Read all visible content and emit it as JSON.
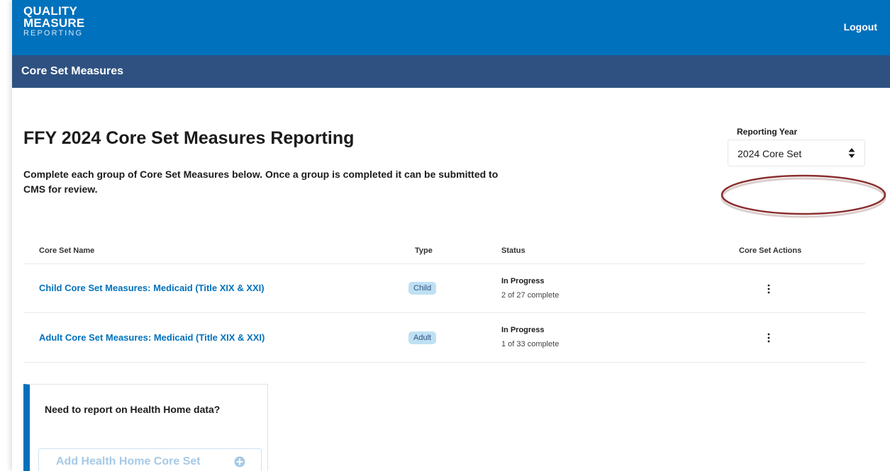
{
  "header": {
    "logo_line1": "QUALITY",
    "logo_line2": "MEASURE",
    "logo_line3": "REPORTING",
    "logout_label": "Logout",
    "primary_color": "#0071bc"
  },
  "subheader": {
    "title": "Core Set Measures",
    "color": "#2e5181"
  },
  "page": {
    "title": "FFY 2024 Core Set Measures Reporting",
    "intro": "Complete each group of Core Set Measures below. Once a group is completed it can be submitted to CMS for review."
  },
  "reporting_year": {
    "label": "Reporting Year",
    "selected": "2024 Core Set",
    "icon": "sort-arrows-icon"
  },
  "annotation": {
    "color": "#8b2e2e",
    "icon": "highlight-oval"
  },
  "table": {
    "headers": {
      "name": "Core Set Name",
      "type": "Type",
      "status": "Status",
      "actions": "Core Set Actions"
    },
    "rows": [
      {
        "name": "Child Core Set Measures: Medicaid (Title XIX & XXI)",
        "type": "Child",
        "status": "In Progress",
        "progress": "2 of 27 complete",
        "actions_icon": "kebab-menu-icon"
      },
      {
        "name": "Adult Core Set Measures: Medicaid (Title XIX & XXI)",
        "type": "Adult",
        "status": "In Progress",
        "progress": "1 of 33 complete",
        "actions_icon": "kebab-menu-icon"
      }
    ]
  },
  "health_home": {
    "prompt": "Need to report on Health Home data?",
    "button_label": "Add Health Home Core Set",
    "button_icon": "plus-circle-icon"
  }
}
